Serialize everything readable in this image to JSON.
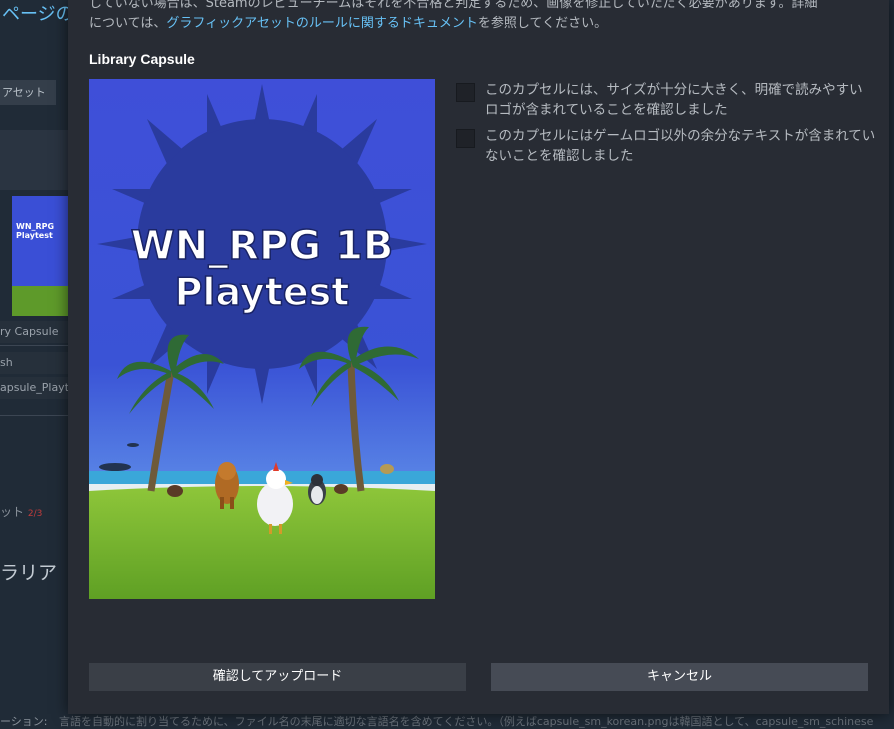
{
  "background": {
    "page_title": "ページの",
    "tab_label": "アセット",
    "thumb_text": "WN_RPG Playtest",
    "labels": [
      "ry Capsule",
      "sh",
      "apsule_Playte"
    ],
    "status_text": "ット",
    "status_red": "2/3",
    "section_heading": "ラリア",
    "bottom_label": "ーション:",
    "bottom_text": "言語を自動的に割り当てるために、ファイル名の末尾に適切な言語名を含めてください。（例えばcapsule_sm_korean.pngは韓国語として、capsule_sm_schinese"
  },
  "modal": {
    "notice_line1": "していない場合は、Steamのレビューチームはそれを不合格と判定するため、画像を修正していただく必要があります。詳細",
    "notice_line2_prefix": "については、",
    "notice_link": "グラフィックアセットのルールに関するドキュメント",
    "notice_line2_suffix": "を参照してください。",
    "section_title": "Library Capsule",
    "capsule_title_line1": "WN_RPG 1B",
    "capsule_title_line2": "Playtest",
    "checkbox1_label": "このカプセルには、サイズが十分に大きく、明確で読みやすいロゴが含まれていることを確認しました",
    "checkbox2_label": "このカプセルにはゲームロゴ以外の余分なテキストが含まれていないことを確認しました",
    "confirm_button": "確認してアップロード",
    "cancel_button": "キャンセル"
  },
  "colors": {
    "accent_link": "#67c1f5",
    "modal_bg": "#282c34",
    "button_confirm": "#3a3f47",
    "button_cancel": "#464b55"
  }
}
